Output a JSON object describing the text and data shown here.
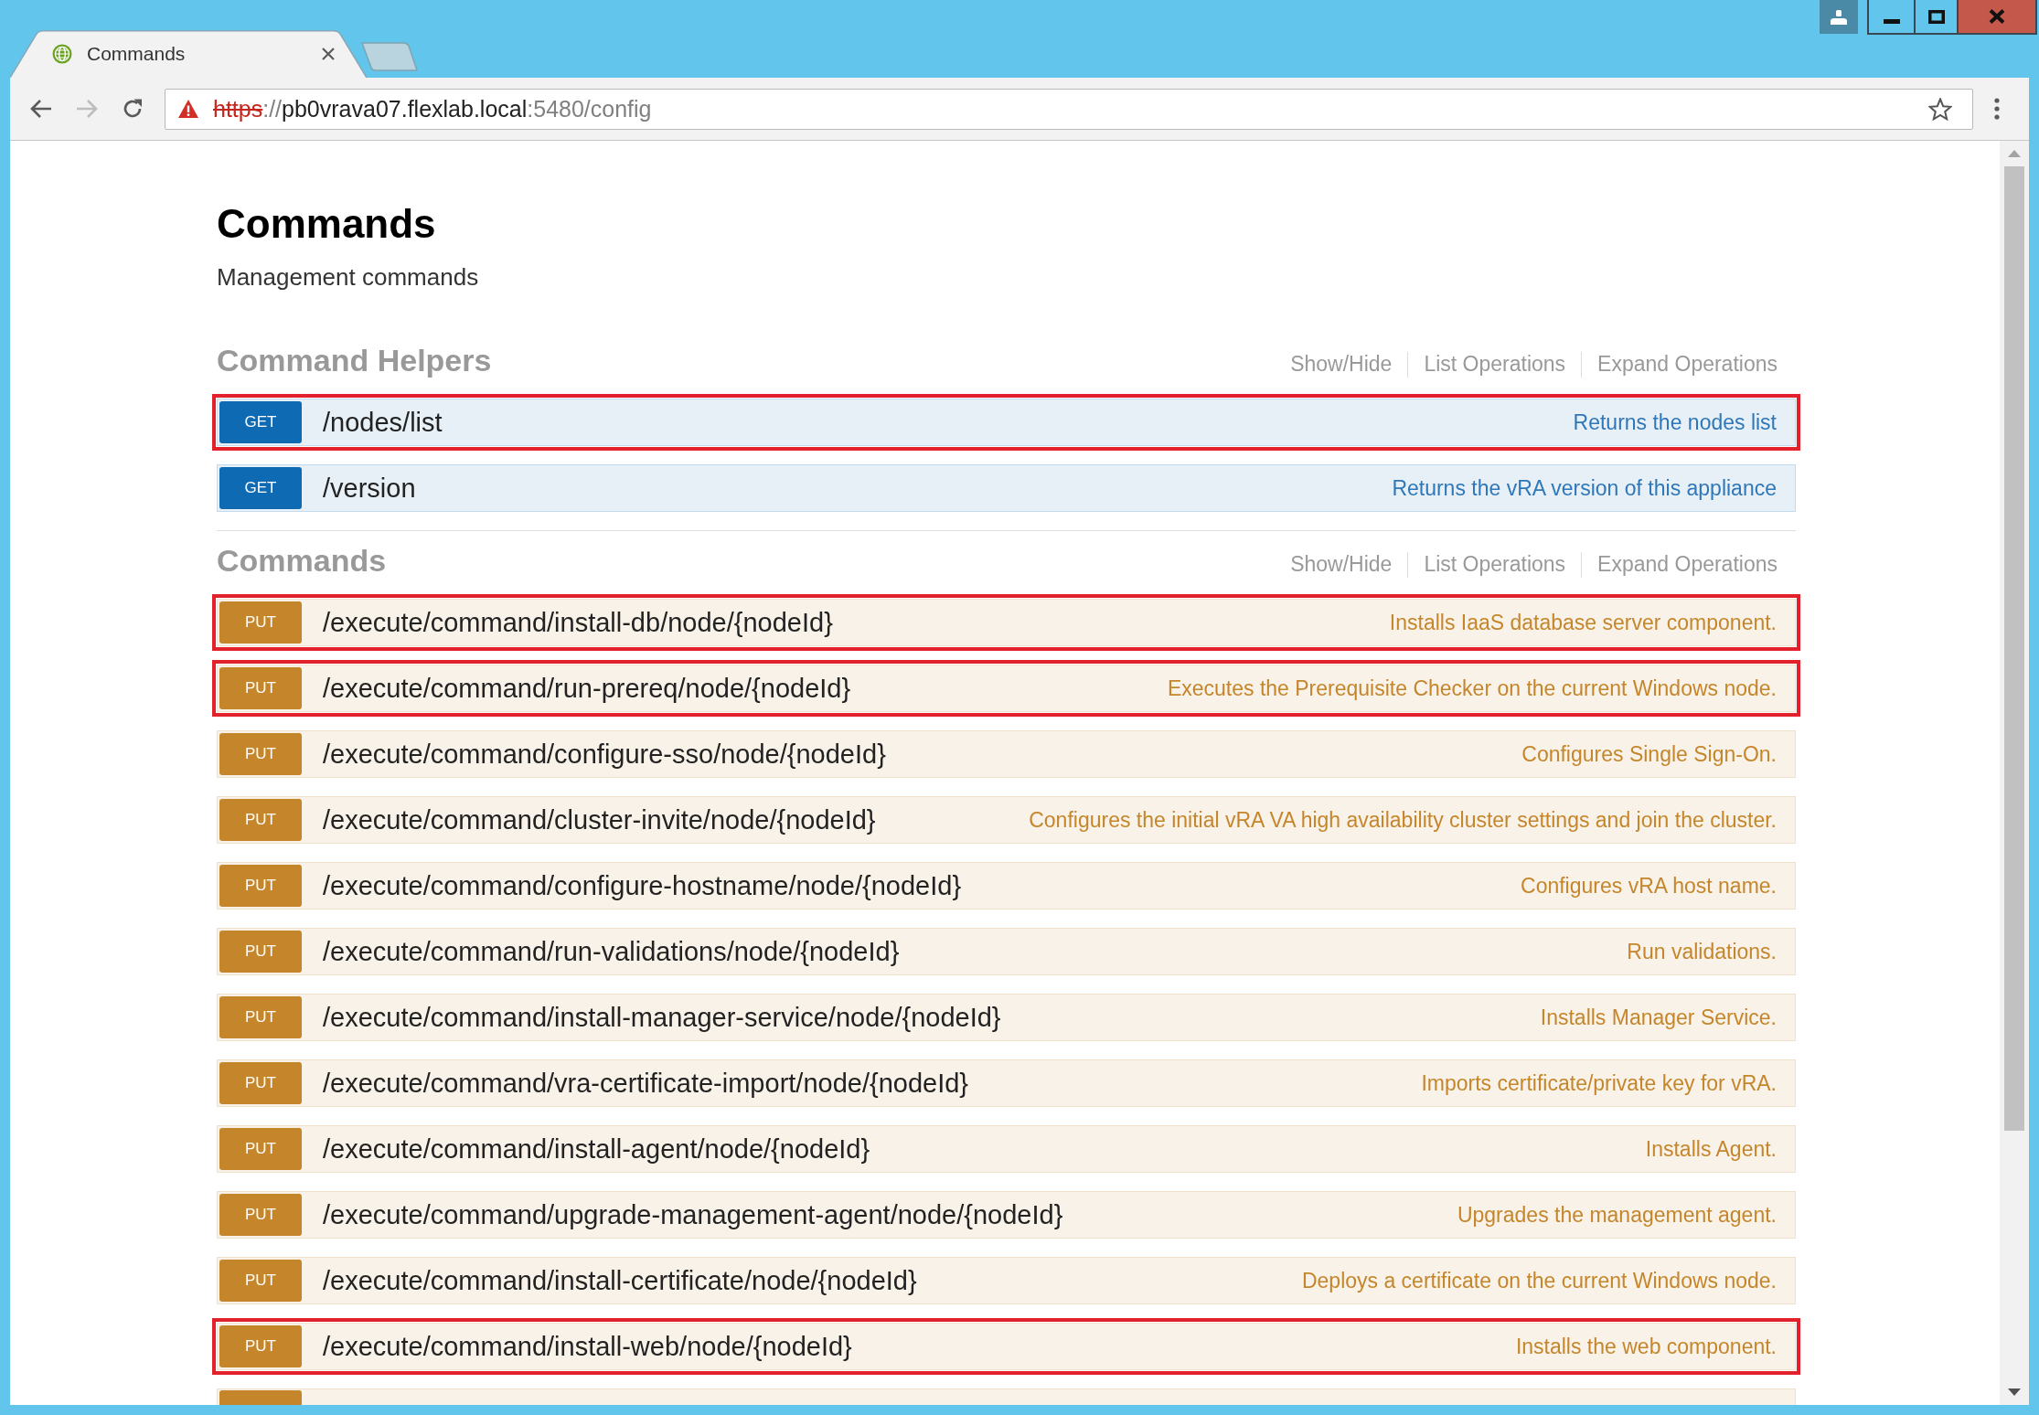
{
  "browser": {
    "tabs": [
      {
        "title": "Commands",
        "selected": true
      }
    ],
    "nav": {
      "back_enabled": true,
      "forward_enabled": false
    },
    "address_bar": {
      "secure": false,
      "scheme": "https",
      "separator": "://",
      "host": "pb0vrava07.flexlab.local",
      "rest": ":5480/config"
    }
  },
  "page": {
    "title": "Commands",
    "description": "Management commands",
    "sections": [
      {
        "name": "Command Helpers",
        "actions": [
          "Show/Hide",
          "List Operations",
          "Expand Operations"
        ],
        "endpoints": [
          {
            "kind": "get",
            "method": "GET",
            "path": "/nodes/list",
            "summary": "Returns the nodes list",
            "highlighted": true
          },
          {
            "kind": "get",
            "method": "GET",
            "path": "/version",
            "summary": "Returns the vRA version of this appliance",
            "highlighted": false
          }
        ]
      },
      {
        "name": "Commands",
        "actions": [
          "Show/Hide",
          "List Operations",
          "Expand Operations"
        ],
        "endpoints": [
          {
            "kind": "put",
            "method": "PUT",
            "path": "/execute/command/install-db/node/{nodeId}",
            "summary": "Installs IaaS database server component.",
            "highlighted": true
          },
          {
            "kind": "put",
            "method": "PUT",
            "path": "/execute/command/run-prereq/node/{nodeId}",
            "summary": "Executes the Prerequisite Checker on the current Windows node.",
            "highlighted": true
          },
          {
            "kind": "put",
            "method": "PUT",
            "path": "/execute/command/configure-sso/node/{nodeId}",
            "summary": "Configures Single Sign-On.",
            "highlighted": false
          },
          {
            "kind": "put",
            "method": "PUT",
            "path": "/execute/command/cluster-invite/node/{nodeId}",
            "summary": "Configures the initial vRA VA high availability cluster settings and join the cluster.",
            "highlighted": false
          },
          {
            "kind": "put",
            "method": "PUT",
            "path": "/execute/command/configure-hostname/node/{nodeId}",
            "summary": "Configures vRA host name.",
            "highlighted": false
          },
          {
            "kind": "put",
            "method": "PUT",
            "path": "/execute/command/run-validations/node/{nodeId}",
            "summary": "Run validations.",
            "highlighted": false
          },
          {
            "kind": "put",
            "method": "PUT",
            "path": "/execute/command/install-manager-service/node/{nodeId}",
            "summary": "Installs Manager Service.",
            "highlighted": false
          },
          {
            "kind": "put",
            "method": "PUT",
            "path": "/execute/command/vra-certificate-import/node/{nodeId}",
            "summary": "Imports certificate/private key for vRA.",
            "highlighted": false
          },
          {
            "kind": "put",
            "method": "PUT",
            "path": "/execute/command/install-agent/node/{nodeId}",
            "summary": "Installs Agent.",
            "highlighted": false
          },
          {
            "kind": "put",
            "method": "PUT",
            "path": "/execute/command/upgrade-management-agent/node/{nodeId}",
            "summary": "Upgrades the management agent.",
            "highlighted": false
          },
          {
            "kind": "put",
            "method": "PUT",
            "path": "/execute/command/install-certificate/node/{nodeId}",
            "summary": "Deploys a certificate on the current Windows node.",
            "highlighted": false
          },
          {
            "kind": "put",
            "method": "PUT",
            "path": "/execute/command/install-web/node/{nodeId}",
            "summary": "Installs the web component.",
            "highlighted": true
          }
        ],
        "clipped_row": {
          "kind": "put"
        }
      }
    ]
  }
}
